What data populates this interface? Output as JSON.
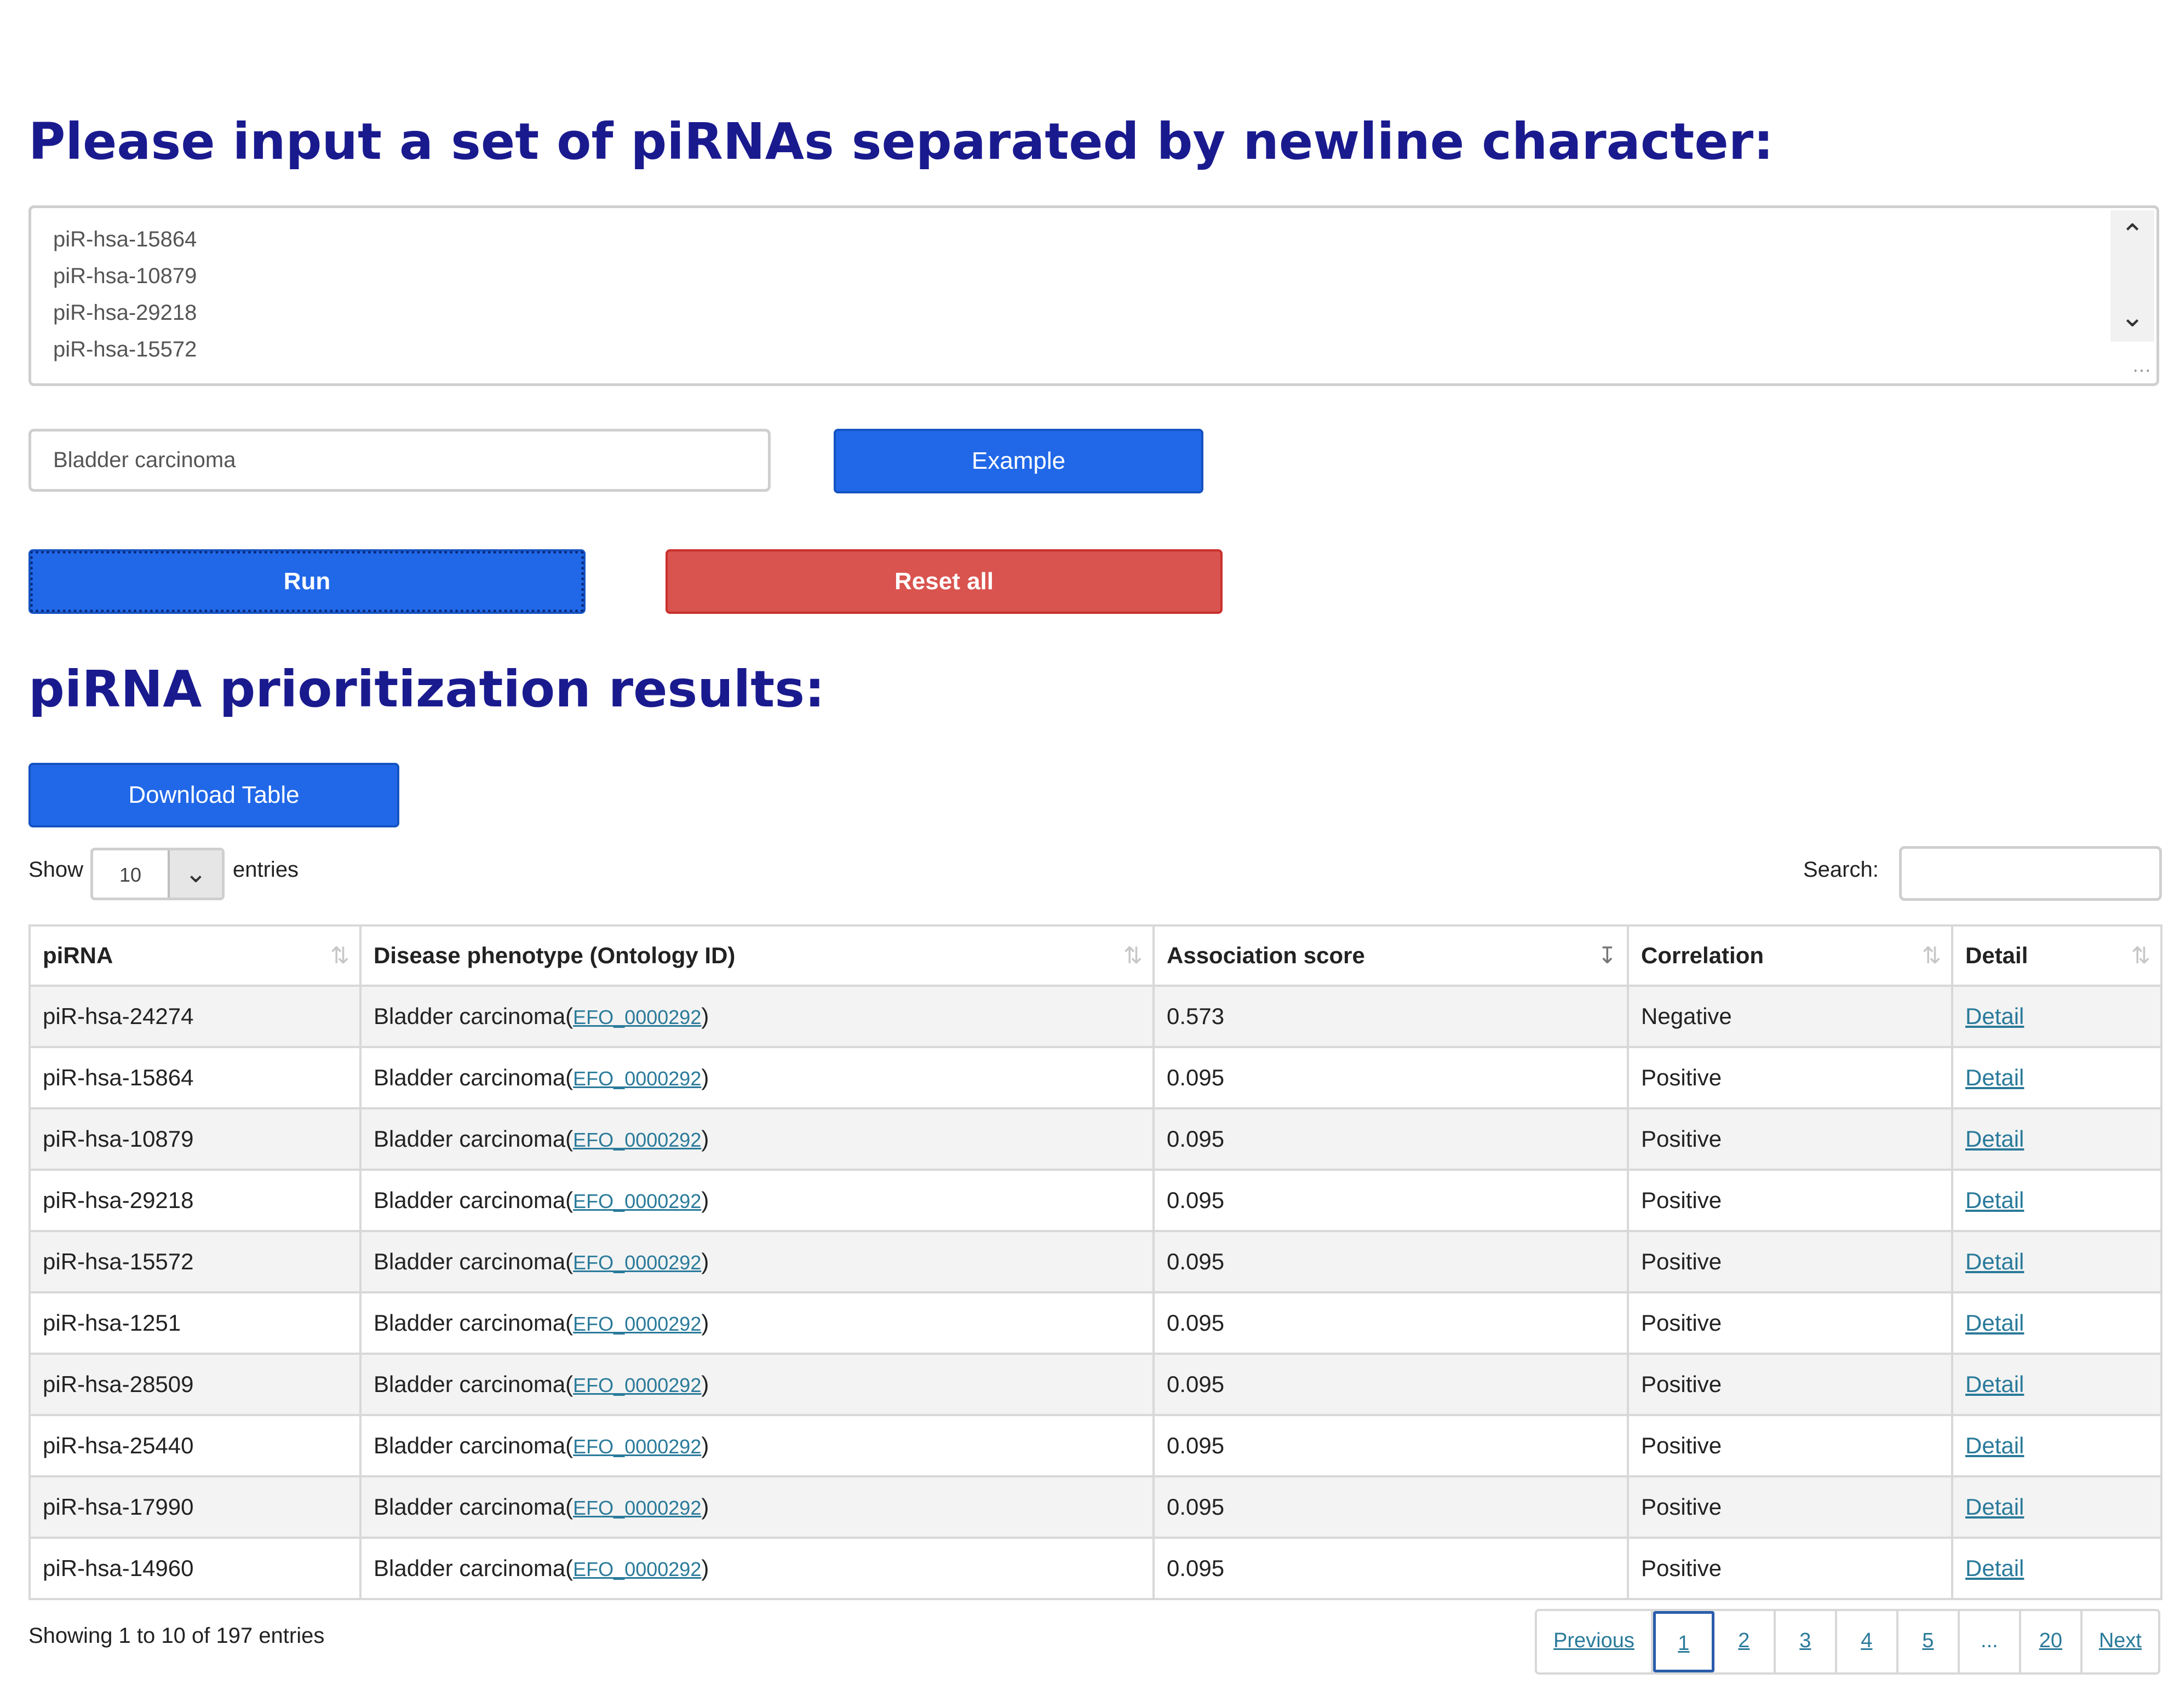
{
  "input_section": {
    "heading": "Please input a set of piRNAs separated by newline character:",
    "textarea_lines": [
      "piR-hsa-15864",
      "piR-hsa-10879",
      "piR-hsa-29218",
      "piR-hsa-15572"
    ],
    "disease_value": "Bladder carcinoma",
    "example_label": "Example",
    "run_label": "Run",
    "reset_label": "Reset all"
  },
  "results_section": {
    "heading": "piRNA prioritization results:",
    "download_label": "Download Table",
    "show_label": "Show",
    "entries_value": "10",
    "entries_label": "entries",
    "search_label": "Search:",
    "columns": [
      "piRNA",
      "Disease phenotype (Ontology ID)",
      "Association score",
      "Correlation",
      "Detail"
    ],
    "rows": [
      {
        "pirna": "piR-hsa-24274",
        "disease": "Bladder carcinoma",
        "ontology_id": "EFO_0000292",
        "score": "0.573",
        "correlation": "Negative",
        "detail": "Detail"
      },
      {
        "pirna": "piR-hsa-15864",
        "disease": "Bladder carcinoma",
        "ontology_id": "EFO_0000292",
        "score": "0.095",
        "correlation": "Positive",
        "detail": "Detail"
      },
      {
        "pirna": "piR-hsa-10879",
        "disease": "Bladder carcinoma",
        "ontology_id": "EFO_0000292",
        "score": "0.095",
        "correlation": "Positive",
        "detail": "Detail"
      },
      {
        "pirna": "piR-hsa-29218",
        "disease": "Bladder carcinoma",
        "ontology_id": "EFO_0000292",
        "score": "0.095",
        "correlation": "Positive",
        "detail": "Detail"
      },
      {
        "pirna": "piR-hsa-15572",
        "disease": "Bladder carcinoma",
        "ontology_id": "EFO_0000292",
        "score": "0.095",
        "correlation": "Positive",
        "detail": "Detail"
      },
      {
        "pirna": "piR-hsa-1251",
        "disease": "Bladder carcinoma",
        "ontology_id": "EFO_0000292",
        "score": "0.095",
        "correlation": "Positive",
        "detail": "Detail"
      },
      {
        "pirna": "piR-hsa-28509",
        "disease": "Bladder carcinoma",
        "ontology_id": "EFO_0000292",
        "score": "0.095",
        "correlation": "Positive",
        "detail": "Detail"
      },
      {
        "pirna": "piR-hsa-25440",
        "disease": "Bladder carcinoma",
        "ontology_id": "EFO_0000292",
        "score": "0.095",
        "correlation": "Positive",
        "detail": "Detail"
      },
      {
        "pirna": "piR-hsa-17990",
        "disease": "Bladder carcinoma",
        "ontology_id": "EFO_0000292",
        "score": "0.095",
        "correlation": "Positive",
        "detail": "Detail"
      },
      {
        "pirna": "piR-hsa-14960",
        "disease": "Bladder carcinoma",
        "ontology_id": "EFO_0000292",
        "score": "0.095",
        "correlation": "Positive",
        "detail": "Detail"
      }
    ],
    "info_text": "Showing 1 to 10 of 197 entries",
    "pagination": {
      "previous": "Previous",
      "pages": [
        "1",
        "2",
        "3",
        "4",
        "5",
        "...",
        "20"
      ],
      "current": "1",
      "next": "Next"
    }
  },
  "colors": {
    "heading": "#1a1a8f",
    "primary_button": "#2168e8",
    "danger_button": "#d9534f",
    "link": "#2a7a9a"
  },
  "icons": {
    "scroll_up": "chevron-up-icon",
    "scroll_down": "chevron-down-icon",
    "select_arrow": "chevron-down-icon",
    "sort": "sort-icon",
    "sort_active": "sort-desc-icon",
    "resize": "resize-grip-icon"
  }
}
